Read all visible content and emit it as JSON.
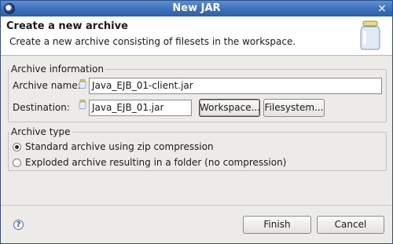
{
  "window": {
    "title": "New JAR",
    "close_glyph": "×"
  },
  "header": {
    "title": "Create a new archive",
    "description": "Create a new archive consisting of filesets in the workspace."
  },
  "archive_info": {
    "group_label": "Archive information",
    "name_label": "Archive name:",
    "name_value": "Java_EJB_01-client.jar",
    "destination_label": "Destination:",
    "destination_value": "Java_EJB_01.jar",
    "workspace_button": "Workspace...",
    "filesystem_button": "Filesystem..."
  },
  "archive_type": {
    "group_label": "Archive type",
    "options": [
      {
        "label": "Standard archive using zip compression",
        "selected": true
      },
      {
        "label": "Exploded archive resulting in a folder (no compression)",
        "selected": false
      }
    ]
  },
  "footer": {
    "help_glyph": "?",
    "finish_button": "Finish",
    "cancel_button": "Cancel"
  }
}
